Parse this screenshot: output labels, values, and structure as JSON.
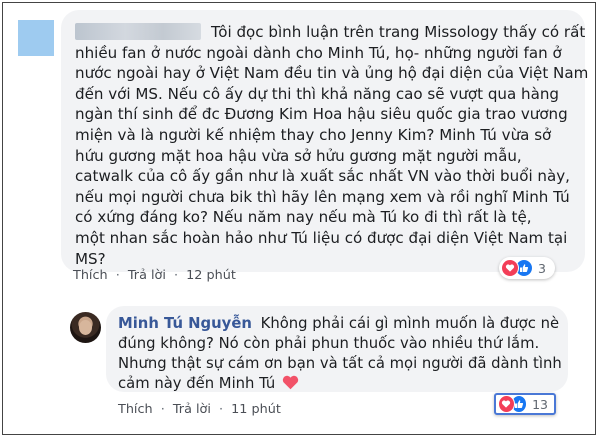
{
  "comment1": {
    "lines": [
      "Tôi đọc bình luận trên trang Missology thấy có rất",
      "nhiều fan ở nước ngoài dành cho Minh Tú, họ- những người fan ở",
      "nước ngoài hay ở Việt Nam đều tin và ủng hộ đại diện của Việt Nam",
      "đến với MS. Nếu cô ấy dự thi thì khả năng cao sẽ vượt qua hàng",
      "ngàn thí sinh để đc Đương Kim Hoa hậu siêu quốc gia trao vương",
      "miện và là người kế nhiệm thay cho Jenny Kim? Minh Tú vừa sở",
      "hứu gương mặt hoa hậu vừa sở hửu gương mặt người mẫu,",
      "catwalk của cô ấy gần như là xuất sắc nhất VN vào thời buổi này,",
      "nếu mọi người chưa bik thì hãy lên mạng xem và rồi nghĩ Minh Tú",
      "có xứng đáng ko? Nếu năm nay nếu mà Tú ko đi thì rất là tệ,",
      "một nhan sắc hoàn hảo như Tú liệu có được đại diện Việt Nam tại",
      "MS?"
    ],
    "meta": {
      "like": "Thích",
      "reply": "Trả lời",
      "time": "12 phút",
      "sep": "·"
    },
    "reaction_count": "3"
  },
  "comment2": {
    "author": "Minh Tú Nguyễn",
    "lines": [
      "Không phải cái gì mình muốn là được nè",
      "đúng không? Nó còn phải phun thuốc vào nhiều thứ lắm.",
      "Nhưng thật sự cám ơn bạn và tất cả mọi người đã dành tình",
      "cảm này đến Minh Tú"
    ],
    "meta": {
      "like": "Thích",
      "reply": "Trả lời",
      "time": "11 phút",
      "sep": "·"
    },
    "reaction_count": "13"
  },
  "colors": {
    "author": "#385898",
    "heart": "#f33e58",
    "like": "#1877f2",
    "bubble": "#f2f3f5"
  }
}
